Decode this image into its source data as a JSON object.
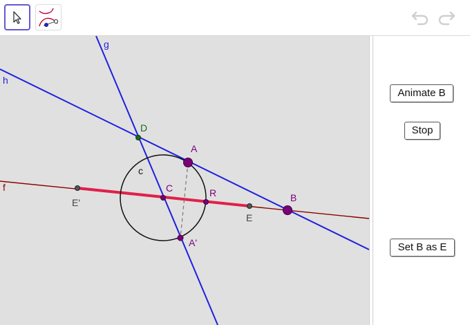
{
  "toolbar": {
    "tools": [
      {
        "name": "move-tool",
        "icon": "cursor-arrow-icon",
        "active": true
      },
      {
        "name": "locus-tool",
        "icon": "locus-curve-icon",
        "active": false
      }
    ],
    "undo_icon": "undo-icon",
    "redo_icon": "redo-icon"
  },
  "graphics": {
    "labels": {
      "g": "g",
      "h": "h",
      "f": "f",
      "c": "c",
      "A": "A",
      "B": "B",
      "C": "C",
      "D": "D",
      "E": "E",
      "E_prime": "E'",
      "R": "R",
      "A_prime": "A'"
    },
    "colors": {
      "background": "#e0e0e0",
      "line_blue": "#1f1fe0",
      "line_f": "#8b0000",
      "segment_red": "#e0204a",
      "point_purple": "#7a007a",
      "point_green": "#1a6b1a",
      "point_gray": "#444444"
    }
  },
  "buttons": {
    "animate_b": "Animate B",
    "stop": "Stop",
    "set_b_as_e": "Set B as E"
  }
}
